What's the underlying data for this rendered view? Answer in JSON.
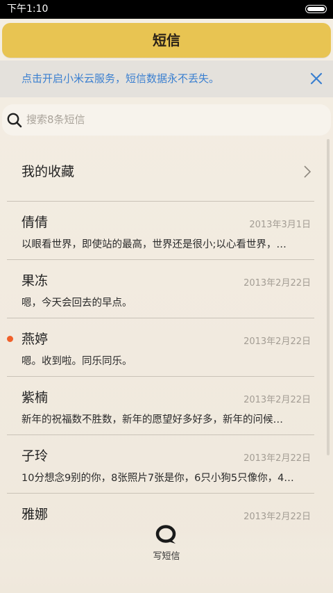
{
  "status_bar": {
    "time": "下午1:10"
  },
  "header": {
    "title": "短信"
  },
  "notice": {
    "text": "点击开启小米云服务，短信数据永不丢失。"
  },
  "search": {
    "placeholder": "搜索8条短信"
  },
  "favorites": {
    "label": "我的收藏"
  },
  "messages": [
    {
      "name": "倩倩",
      "date": "2013年3月1日",
      "preview": "以眼看世界，即使站的最高，世界还是很小;以心看世界，…",
      "unread": false
    },
    {
      "name": "果冻",
      "date": "2013年2月22日",
      "preview": "嗯，今天会回去的早点。",
      "unread": false
    },
    {
      "name": "燕婷",
      "date": "2013年2月22日",
      "preview": "嗯。收到啦。同乐同乐。",
      "unread": true
    },
    {
      "name": "紫楠",
      "date": "2013年2月22日",
      "preview": "新年的祝福数不胜数，新年的愿望好多好多，新年的问候…",
      "unread": false
    },
    {
      "name": "子玲",
      "date": "2013年2月22日",
      "preview": "10分想念9别的你，8张照片7张是你，6只小狗5只像你，4…",
      "unread": false
    },
    {
      "name": "雅娜",
      "date": "2013年2月22日",
      "preview": "",
      "unread": false
    }
  ],
  "compose": {
    "label": "写短信"
  },
  "colors": {
    "accent": "#e8c452",
    "link": "#3a7fd0",
    "unread_dot": "#f0602a"
  }
}
